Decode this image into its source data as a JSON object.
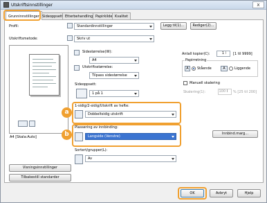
{
  "window": {
    "title": "Utskriftsinnstillinger",
    "close_glyph": "x"
  },
  "tabs": [
    {
      "label": "Grunninnstillinger",
      "active": true
    },
    {
      "label": "Sideoppsett"
    },
    {
      "label": "Etterbehandling"
    },
    {
      "label": "Papirkilde"
    },
    {
      "label": "Kvalitet"
    }
  ],
  "profile": {
    "label": "Profil:",
    "value": "Standardinnstillinger",
    "add_btn": "Legg til(1)...",
    "edit_btn": "Rediger(2)..."
  },
  "output_method": {
    "label": "Utskriftsmetode:",
    "value": "Skriv ut"
  },
  "preview": {
    "caption": "A4 [Skala:Auto]",
    "view_settings_btn": "Visningsinnstillinger",
    "reset_btn": "Tilbakestill standarder"
  },
  "page_size": {
    "label": "Sidestørrelse(W):",
    "value": "A4"
  },
  "output_size": {
    "label": "Utskriftsstørrelse:",
    "value": "Tilpass sidestørrelse"
  },
  "page_layout": {
    "label": "Sideoppsett:",
    "value": "1 på 1"
  },
  "copies": {
    "label": "Antall kopier(C):",
    "value": "1",
    "range": "[1 til 9999]"
  },
  "orientation": {
    "label": "Papirretning",
    "portrait": "Stående",
    "landscape": "Liggende"
  },
  "manual_scaling": {
    "label": "Manuell skalering",
    "scaling_label": "Skalering(1):",
    "value": "100",
    "range": "% [25 til 200]"
  },
  "duplex": {
    "label": "1-sidig/2-sidig/Utskrift av hefte:",
    "value": "Dobbeltsidig utskrift"
  },
  "binding": {
    "label": "Plassering av innbinding:",
    "value": "Langside (Venstre)",
    "margin_btn": "Innbind.marg..."
  },
  "color_mode": {
    "label": "Sortert/grupper(L):",
    "value": "Av"
  },
  "footer": {
    "ok": "OK",
    "cancel": "Avbryt",
    "help": "Hjelp"
  },
  "badges": {
    "a": "a",
    "b": "b"
  }
}
